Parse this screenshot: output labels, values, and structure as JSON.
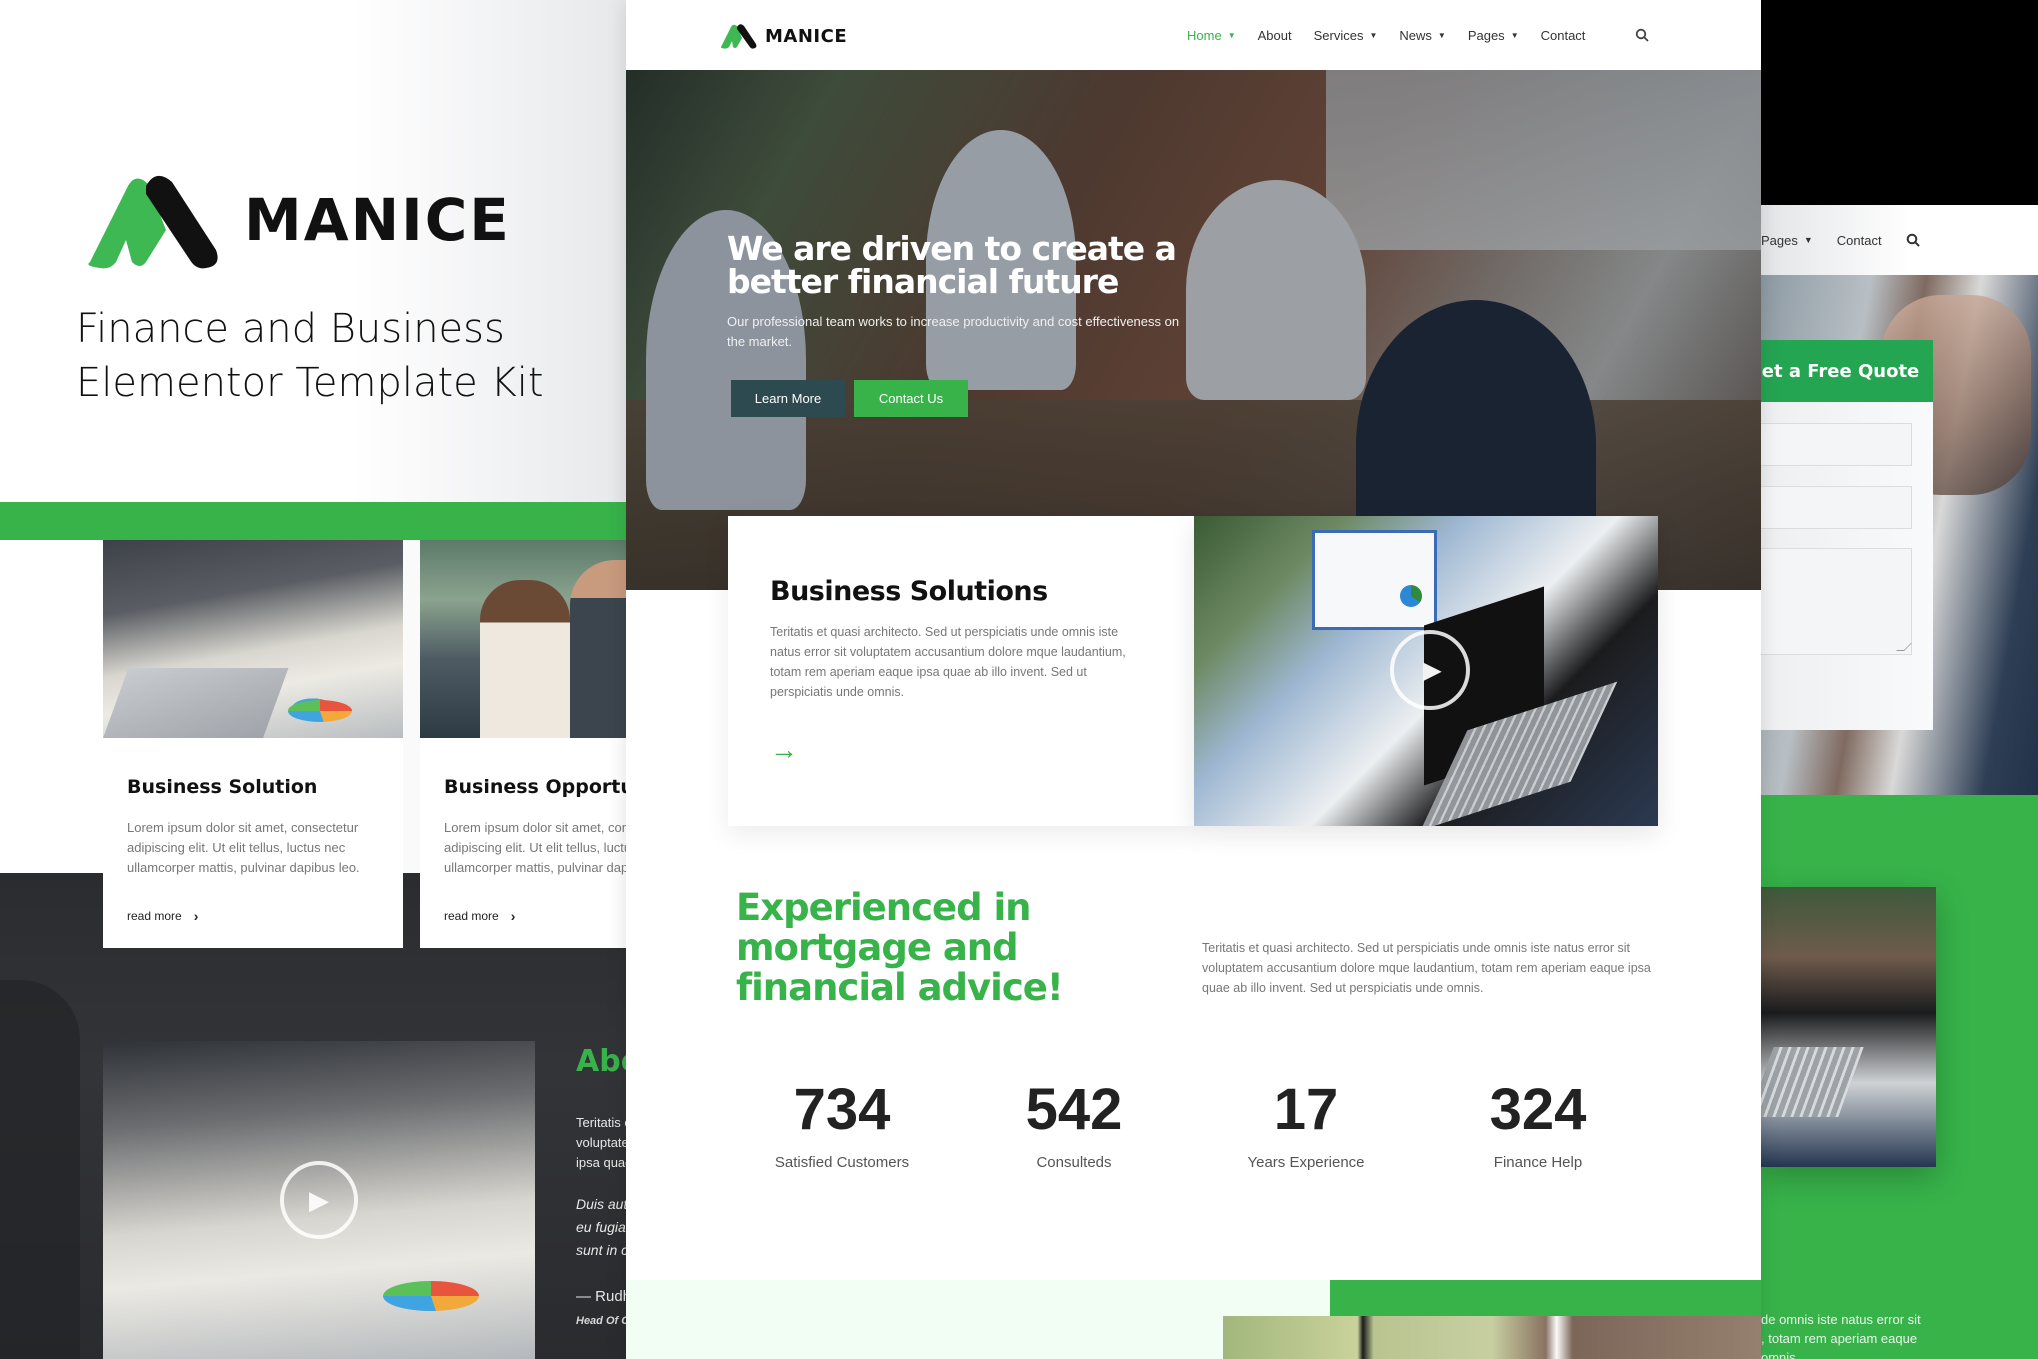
{
  "promo": {
    "brand_name": "MANICE",
    "kit_title": "Finance and Business Elementor Template Kit"
  },
  "left_preview": {
    "cards": [
      {
        "title": "Business Solution",
        "text": "Lorem ipsum dolor sit amet, consectetur adipiscing elit. Ut elit tellus, luctus nec ullamcorper mattis, pulvinar dapibus leo.",
        "link": "read more"
      },
      {
        "title": "Business Opportunity",
        "text": "Lorem ipsum dolor sit amet, consectetur adipiscing elit. Ut elit tellus, luctus nec ullamcorper mattis, pulvinar dapibus leo.",
        "link": "read more"
      }
    ],
    "about": {
      "title": "About",
      "text_lines": [
        "Teritatis et quasi architecto.",
        "voluptatem accusantium",
        "ipsa quae ab illo invent."
      ],
      "quote_lines": [
        "Duis aute irure dolor",
        "eu fugiat nulla pariatur",
        "sunt in culpa qui officia"
      ],
      "author": "— Rudh",
      "role": "Head Of C"
    }
  },
  "nav": {
    "brand": "MANICE",
    "items": [
      {
        "label": "Home",
        "has_dropdown": true,
        "active": true
      },
      {
        "label": "About",
        "has_dropdown": false,
        "active": false
      },
      {
        "label": "Services",
        "has_dropdown": true,
        "active": false
      },
      {
        "label": "News",
        "has_dropdown": true,
        "active": false
      },
      {
        "label": "Pages",
        "has_dropdown": true,
        "active": false
      },
      {
        "label": "Contact",
        "has_dropdown": false,
        "active": false
      }
    ],
    "search_icon": "search-icon"
  },
  "hero": {
    "title_line1": "We are driven to create a",
    "title_line2": "better financial future",
    "subtitle": "Our professional team works to increase productivity and cost effectiveness on the market.",
    "btn_primary": "Learn More",
    "btn_secondary": "Contact Us"
  },
  "business_solutions": {
    "title": "Business Solutions",
    "text": "Teritatis et quasi architecto. Sed ut perspiciatis unde omnis iste natus error sit voluptatem accusantium dolore mque laudantium, totam rem aperiam eaque ipsa quae ab illo invent. Sed ut perspiciatis unde omnis.",
    "arrow_icon": "arrow-right-icon",
    "video_icon": "play-icon"
  },
  "experience": {
    "title": "Experienced in mortgage and financial advice!",
    "text": "Teritatis et quasi architecto. Sed ut perspiciatis unde omnis iste natus error sit voluptatem accusantium dolore mque laudantium, totam rem aperiam eaque ipsa quae ab illo invent. Sed ut perspiciatis unde omnis."
  },
  "stats": [
    {
      "value": "734",
      "label": "Satisfied Customers"
    },
    {
      "value": "542",
      "label": "Consulteds"
    },
    {
      "value": "17",
      "label": "Years Experience"
    },
    {
      "value": "324",
      "label": "Finance Help"
    }
  ],
  "right_preview": {
    "nav_items": [
      {
        "label": "Pages",
        "has_dropdown": true
      },
      {
        "label": "Contact",
        "has_dropdown": false
      }
    ],
    "form_title": "Get a Free Quote",
    "text_lines": [
      "de omnis iste natus error sit",
      ", totam rem aperiam eaque",
      "omnis."
    ]
  },
  "colors": {
    "brand_green": "#37b34a",
    "form_header_green": "#24a552",
    "button_dark": "#2c4a50",
    "text_dark": "#111111",
    "text_muted": "#777777"
  }
}
